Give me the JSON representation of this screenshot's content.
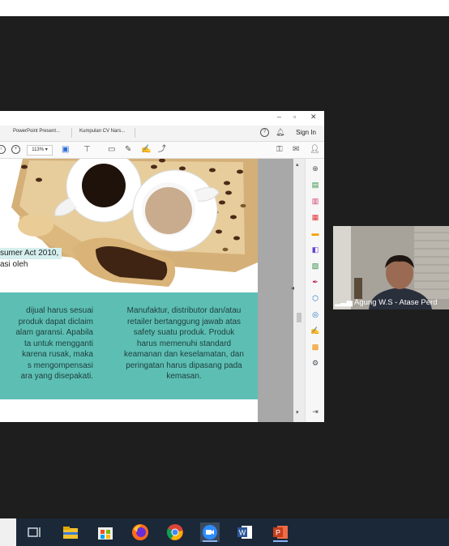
{
  "share": {
    "tabs": [
      "PowerPoint Present...",
      "Kumpulan CV Nars..."
    ],
    "sign_in": "Sign In",
    "zoom": "113%",
    "doc": {
      "quote_line1": "sumer Act 2010,",
      "quote_line2": "asi oleh",
      "left_col": [
        "dijual harus sesuai",
        "produk dapat diclaim",
        "alam garansi. Apabila",
        "ta untuk mengganti",
        "karena rusak, maka",
        "s mengompensasi",
        "ara yang disepakati."
      ],
      "right_col": [
        "Manufaktur, distributor dan/atau",
        "retailer bertanggung jawab atas",
        "safety suatu produk. Produk",
        "harus memenuhi standard",
        "keamanan dan keselamatan, dan",
        "peringatan harus dipasang pada",
        "kemasan."
      ]
    }
  },
  "participant": {
    "name": "Agung W.S - Atase Perd"
  },
  "taskbar": {
    "apps": [
      "task-view",
      "file-explorer",
      "microsoft-store",
      "firefox",
      "chrome",
      "zoom",
      "word",
      "powerpoint"
    ]
  }
}
